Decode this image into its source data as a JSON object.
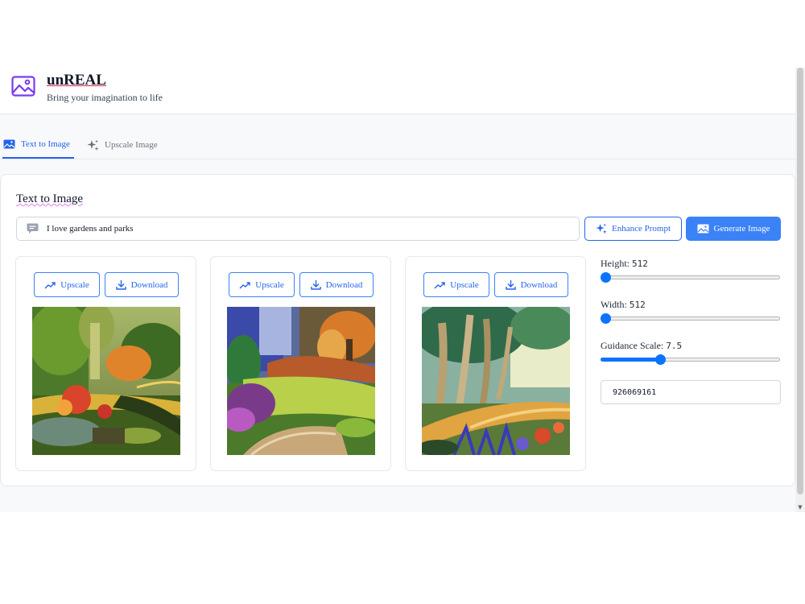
{
  "header": {
    "title": "unREAL",
    "subtitle": "Bring your imagination to life",
    "logo_icon": "image-icon",
    "accent_color": "#7c3aed"
  },
  "tabs": [
    {
      "label": "Text to Image",
      "icon": "image-icon",
      "active": true
    },
    {
      "label": "Upscale Image",
      "icon": "sparkles-icon",
      "active": false
    }
  ],
  "main": {
    "section_title": "Text to Image",
    "prompt": {
      "value": "I love gardens and parks",
      "placeholder": ""
    },
    "enhance_label": "Enhance Prompt",
    "generate_label": "Generate Image",
    "primary_color": "#3b82f6"
  },
  "images": [
    {
      "upscale_label": "Upscale",
      "download_label": "Download"
    },
    {
      "upscale_label": "Upscale",
      "download_label": "Download"
    },
    {
      "upscale_label": "Upscale",
      "download_label": "Download"
    }
  ],
  "controls": {
    "height": {
      "label": "Height:",
      "value": "512",
      "fraction": 0.0
    },
    "width": {
      "label": "Width:",
      "value": "512",
      "fraction": 0.0
    },
    "guidance": {
      "label": "Guidance Scale:",
      "value": "7.5",
      "fraction": 0.33
    },
    "seed": "926069161"
  }
}
